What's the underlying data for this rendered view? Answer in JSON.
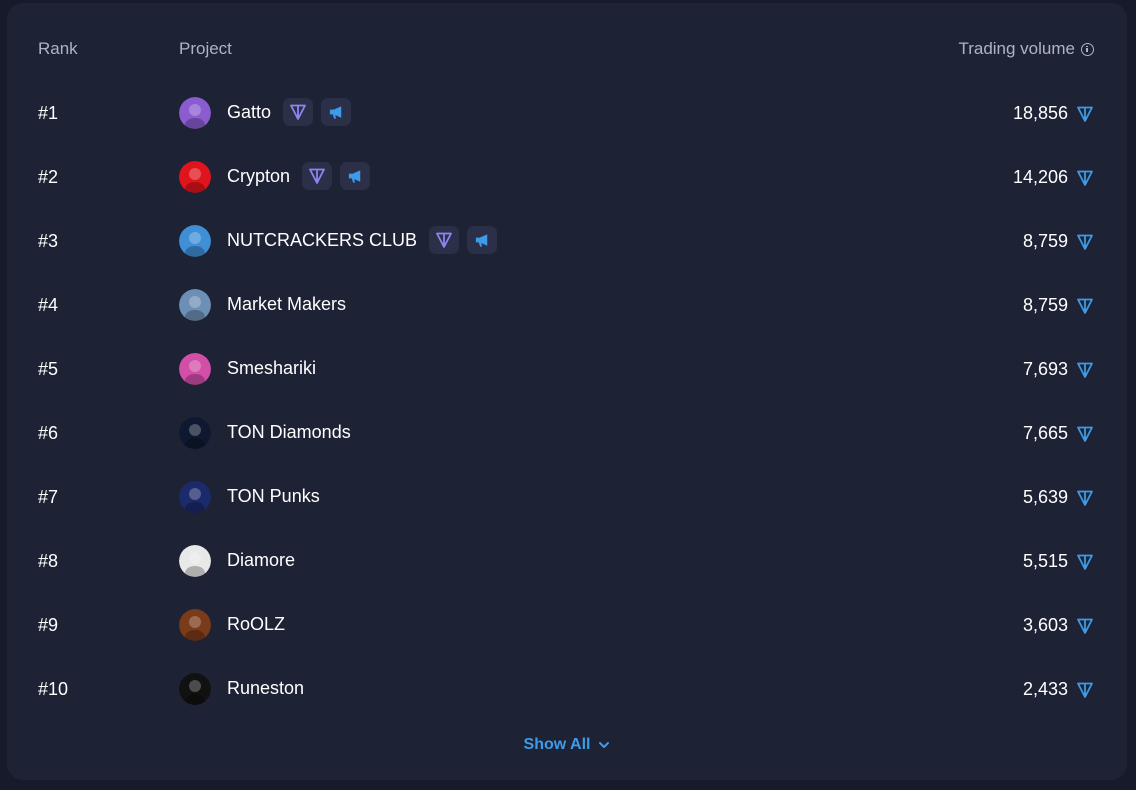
{
  "header": {
    "rank_label": "Rank",
    "project_label": "Project",
    "volume_label": "Trading volume"
  },
  "rows": [
    {
      "rank": "#1",
      "name": "Gatto",
      "volume": "18,856",
      "badges": true,
      "avatar_color": "#8a5ccf"
    },
    {
      "rank": "#2",
      "name": "Crypton",
      "volume": "14,206",
      "badges": true,
      "avatar_color": "#e0141c"
    },
    {
      "rank": "#3",
      "name": "NUTCRACKERS CLUB",
      "volume": "8,759",
      "badges": true,
      "avatar_color": "#3f8fd6"
    },
    {
      "rank": "#4",
      "name": "Market Makers",
      "volume": "8,759",
      "badges": false,
      "avatar_color": "#6e8fb5"
    },
    {
      "rank": "#5",
      "name": "Smeshariki",
      "volume": "7,693",
      "badges": false,
      "avatar_color": "#d24fa8"
    },
    {
      "rank": "#6",
      "name": "TON Diamonds",
      "volume": "7,665",
      "badges": false,
      "avatar_color": "#0e1830"
    },
    {
      "rank": "#7",
      "name": "TON Punks",
      "volume": "5,639",
      "badges": false,
      "avatar_color": "#1b2a6b"
    },
    {
      "rank": "#8",
      "name": "Diamore",
      "volume": "5,515",
      "badges": false,
      "avatar_color": "#e8e8e8"
    },
    {
      "rank": "#9",
      "name": "RoOLZ",
      "volume": "3,603",
      "badges": false,
      "avatar_color": "#7a3b1a"
    },
    {
      "rank": "#10",
      "name": "Runeston",
      "volume": "2,433",
      "badges": false,
      "avatar_color": "#111111"
    }
  ],
  "footer": {
    "show_all_label": "Show All"
  },
  "icons": {
    "info": "info-icon",
    "ton": "ton-icon",
    "verified": "ton-verified-badge-icon",
    "promo": "megaphone-icon",
    "chevron": "chevron-down-icon"
  },
  "colors": {
    "page_bg": "#171a2a",
    "card_bg": "#1e2235",
    "header_text": "#aeb4c5",
    "ton_blue": "#3d9be9",
    "badge_purple": "#8a86f0",
    "badge_bg": "#2b3048"
  }
}
